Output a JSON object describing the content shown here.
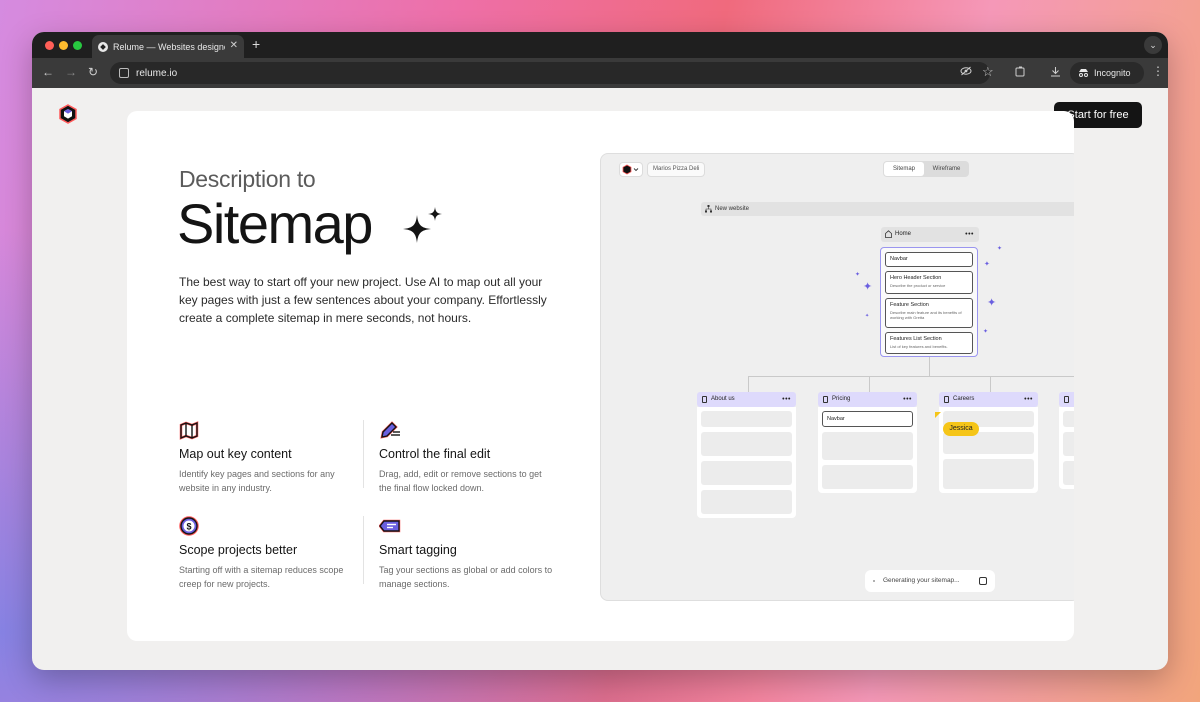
{
  "browser": {
    "tab_title": "Relume — Websites designed",
    "new_tab": "+",
    "tab_close": "✕",
    "tab_menu": "⌄",
    "url": "relume.io",
    "incognito_label": "Incognito",
    "traffic_colors": [
      "#ff5f57",
      "#febc2e",
      "#28c840"
    ]
  },
  "header": {
    "cta_label": "Start for free"
  },
  "hero": {
    "kicker": "Description to",
    "headline": "Sitemap",
    "description": "The best way to start off your new project. Use AI to map out all your key pages with just a few sentences about your company. Effortlessly create a complete sitemap in mere seconds, not hours."
  },
  "features": [
    {
      "icon": "map-icon",
      "title": "Map out key content",
      "text": "Identify key pages and sections for any website in any industry."
    },
    {
      "icon": "edit-icon",
      "title": "Control the final edit",
      "text": "Drag, add, edit or remove sections to get the final flow locked down."
    },
    {
      "icon": "dollar-icon",
      "title": "Scope projects better",
      "text": "Starting off with a sitemap reduces scope creep for new projects."
    },
    {
      "icon": "tag-icon",
      "title": "Smart tagging",
      "text": "Tag your sections as global or add colors to manage sections."
    }
  ],
  "app": {
    "project_name": "Marios Pizza Deli",
    "view_tabs": [
      "Sitemap",
      "Wireframe"
    ],
    "new_website": "New website",
    "home": {
      "title": "Home",
      "sections": [
        {
          "title": "Navbar",
          "desc": ""
        },
        {
          "title": "Hero Header Section",
          "desc": "Describe the product or service"
        },
        {
          "title": "Feature Section",
          "desc": "Describe main feature and its benefits of working with Gretta"
        },
        {
          "title": "Features List Section",
          "desc": "List of key features and benefits."
        }
      ]
    },
    "pages": [
      {
        "title": "About us"
      },
      {
        "title": "Pricing",
        "navbar": "Navbar"
      },
      {
        "title": "Careers"
      }
    ],
    "collaborator": "Jessica",
    "status": "Generating your sitemap...",
    "menu_glyph": "•••"
  },
  "colors": {
    "accent": "#6a5fe0",
    "page_header": "#dedafc",
    "collaborator": "#f5c518"
  }
}
